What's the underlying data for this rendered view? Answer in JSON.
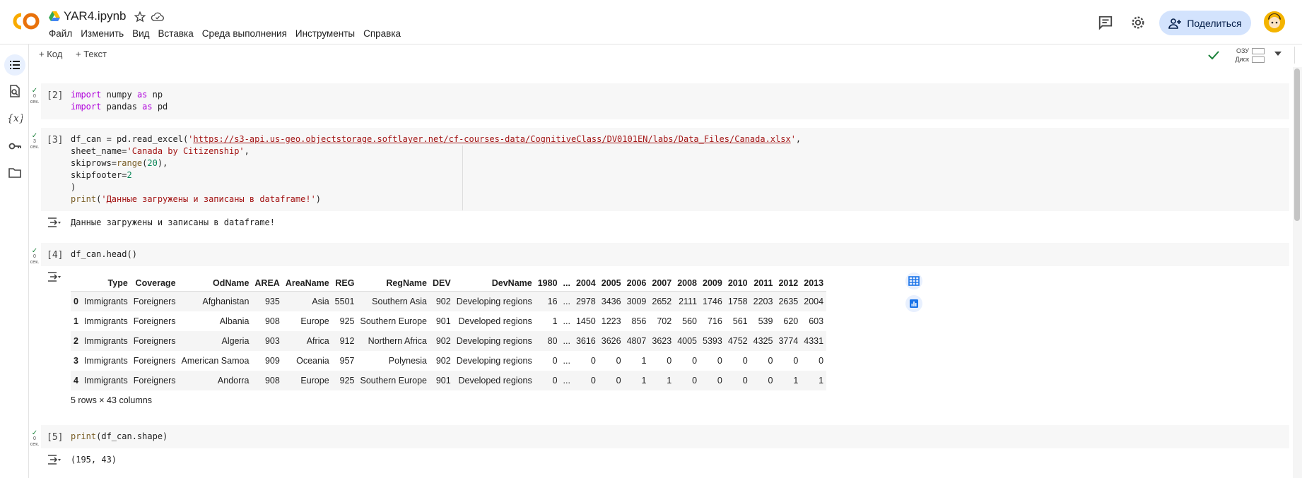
{
  "header": {
    "notebook_title": "YAR4.ipynb",
    "menu": [
      "Файл",
      "Изменить",
      "Вид",
      "Вставка",
      "Среда выполнения",
      "Инструменты",
      "Справка"
    ],
    "share_label": "Поделиться"
  },
  "toolbar": {
    "add_code": "+ Код",
    "add_text": "+ Текст",
    "ram_label": "ОЗУ",
    "disk_label": "Диск"
  },
  "cells": [
    {
      "exec": "[2]",
      "time": "0",
      "unit": "сек.",
      "lines": [
        "import numpy as np",
        "import pandas as pd"
      ]
    },
    {
      "exec": "[3]",
      "time": "3",
      "unit": "сек.",
      "lines": [
        "df_can = pd.read_excel('https://s3-api.us-geo.objectstorage.softlayer.net/cf-courses-data/CognitiveClass/DV0101EN/labs/Data_Files/Canada.xlsx',",
        "sheet_name='Canada by Citizenship',",
        "skiprows=range(20),",
        "skipfooter=2",
        ")",
        "print('Данные загружены и записаны в dataframe!')"
      ],
      "output": "Данные загружены и записаны в dataframe!"
    },
    {
      "exec": "[4]",
      "time": "0",
      "unit": "сек.",
      "lines": [
        "df_can.head()"
      ]
    },
    {
      "exec": "[5]",
      "time": "0",
      "unit": "сек.",
      "lines": [
        "print(df_can.shape)"
      ],
      "output": "(195, 43)"
    }
  ],
  "dataframe": {
    "columns": [
      "",
      "Type",
      "Coverage",
      "OdName",
      "AREA",
      "AreaName",
      "REG",
      "RegName",
      "DEV",
      "DevName",
      "1980",
      "...",
      "2004",
      "2005",
      "2006",
      "2007",
      "2008",
      "2009",
      "2010",
      "2011",
      "2012",
      "2013"
    ],
    "rows": [
      [
        "0",
        "Immigrants",
        "Foreigners",
        "Afghanistan",
        "935",
        "Asia",
        "5501",
        "Southern Asia",
        "902",
        "Developing regions",
        "16",
        "...",
        "2978",
        "3436",
        "3009",
        "2652",
        "2111",
        "1746",
        "1758",
        "2203",
        "2635",
        "2004"
      ],
      [
        "1",
        "Immigrants",
        "Foreigners",
        "Albania",
        "908",
        "Europe",
        "925",
        "Southern Europe",
        "901",
        "Developed regions",
        "1",
        "...",
        "1450",
        "1223",
        "856",
        "702",
        "560",
        "716",
        "561",
        "539",
        "620",
        "603"
      ],
      [
        "2",
        "Immigrants",
        "Foreigners",
        "Algeria",
        "903",
        "Africa",
        "912",
        "Northern Africa",
        "902",
        "Developing regions",
        "80",
        "...",
        "3616",
        "3626",
        "4807",
        "3623",
        "4005",
        "5393",
        "4752",
        "4325",
        "3774",
        "4331"
      ],
      [
        "3",
        "Immigrants",
        "Foreigners",
        "American Samoa",
        "909",
        "Oceania",
        "957",
        "Polynesia",
        "902",
        "Developing regions",
        "0",
        "...",
        "0",
        "0",
        "1",
        "0",
        "0",
        "0",
        "0",
        "0",
        "0",
        "0"
      ],
      [
        "4",
        "Immigrants",
        "Foreigners",
        "Andorra",
        "908",
        "Europe",
        "925",
        "Southern Europe",
        "901",
        "Developed regions",
        "0",
        "...",
        "0",
        "0",
        "1",
        "1",
        "0",
        "0",
        "0",
        "0",
        "1",
        "1"
      ]
    ],
    "caption": "5 rows × 43 columns"
  },
  "colors": {
    "accent": "#1a73e8",
    "share_bg": "#d3e3fd",
    "ok_green": "#188038",
    "keyword": "#af00db",
    "string": "#a31515"
  }
}
